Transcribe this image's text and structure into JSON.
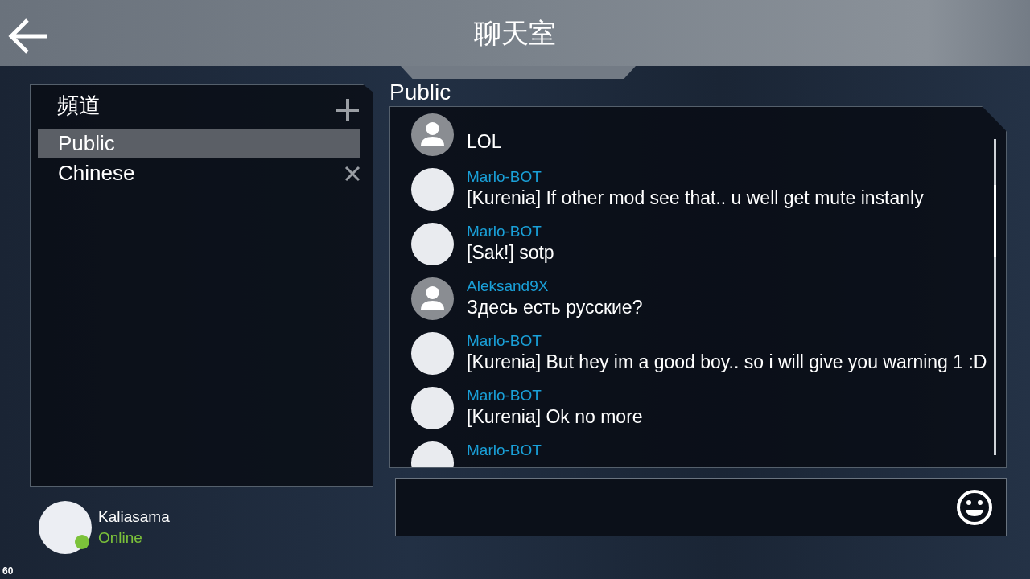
{
  "header": {
    "title": "聊天室"
  },
  "channels_panel": {
    "title": "頻道",
    "items": [
      {
        "name": "Public",
        "selected": true,
        "closable": false
      },
      {
        "name": "Chinese",
        "selected": false,
        "closable": true
      }
    ]
  },
  "chat": {
    "channel_title": "Public",
    "messages": [
      {
        "placeholder_avatar": true,
        "text": "LOL"
      },
      {
        "placeholder_avatar": false,
        "author": "Marlo-BOT",
        "text": "[Kurenia] If other mod see that.. u well get mute instanly"
      },
      {
        "placeholder_avatar": false,
        "author": "Marlo-BOT",
        "text": "[Sak!] sotp"
      },
      {
        "placeholder_avatar": true,
        "author": "Aleksand9X",
        "text": "Здесь есть русские?"
      },
      {
        "placeholder_avatar": false,
        "author": "Marlo-BOT",
        "text": "[Kurenia] But hey im a good boy.. so i will give you warning 1 :D"
      },
      {
        "placeholder_avatar": false,
        "author": "Marlo-BOT",
        "text": "[Kurenia] Ok no more"
      },
      {
        "placeholder_avatar": false,
        "author": "Marlo-BOT"
      }
    ]
  },
  "user": {
    "name": "Kaliasama",
    "status": "Online",
    "online": true
  },
  "fps": "60"
}
